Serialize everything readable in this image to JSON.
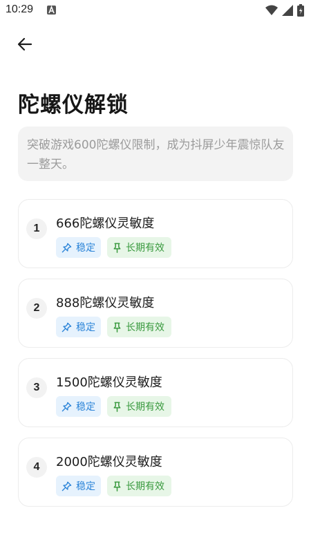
{
  "status_bar": {
    "time": "10:29",
    "icons": [
      "notification-a-icon",
      "wifi-icon",
      "signal-icon",
      "battery-icon"
    ]
  },
  "header": {
    "back_icon": "arrow-left-icon"
  },
  "page": {
    "title": "陀螺仪解锁",
    "description": "突破游戏600陀螺仪限制，成为抖屏少年震惊队友一整天。"
  },
  "items": [
    {
      "number": "1",
      "title": "666陀螺仪灵敏度",
      "tag_stable": "稳定",
      "tag_longterm": "长期有效"
    },
    {
      "number": "2",
      "title": "888陀螺仪灵敏度",
      "tag_stable": "稳定",
      "tag_longterm": "长期有效"
    },
    {
      "number": "3",
      "title": "1500陀螺仪灵敏度",
      "tag_stable": "稳定",
      "tag_longterm": "长期有效"
    },
    {
      "number": "4",
      "title": "2000陀螺仪灵敏度",
      "tag_stable": "稳定",
      "tag_longterm": "长期有效"
    }
  ],
  "colors": {
    "stable_tag_bg": "#e6f2fd",
    "stable_tag_text": "#2b84d8",
    "longterm_tag_bg": "#e7f6e7",
    "longterm_tag_text": "#3a9a3f"
  }
}
